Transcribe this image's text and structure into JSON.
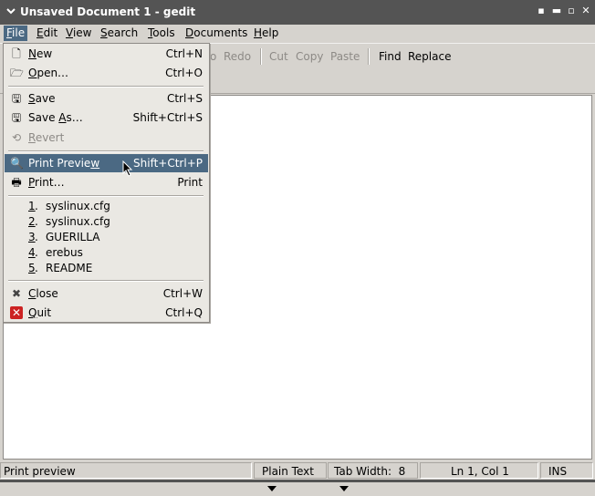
{
  "window": {
    "title": "Unsaved Document 1 - gedit"
  },
  "menubar": {
    "items": [
      {
        "label": "File",
        "u": "F",
        "rest": "ile"
      },
      {
        "label": "Edit",
        "u": "E",
        "rest": "dit"
      },
      {
        "label": "View",
        "u": "V",
        "rest": "iew"
      },
      {
        "label": "Search",
        "u": "S",
        "rest": "earch"
      },
      {
        "label": "Tools",
        "u": "T",
        "rest": "ools"
      },
      {
        "label": "Documents",
        "u": "D",
        "rest": "ocuments"
      },
      {
        "label": "Help",
        "u": "H",
        "rest": "elp"
      }
    ]
  },
  "toolbar": {
    "undo_fragment": "o",
    "redo": "Redo",
    "cut": "Cut",
    "copy": "Copy",
    "paste": "Paste",
    "find": "Find",
    "replace": "Replace"
  },
  "file_menu": {
    "new": {
      "u": "N",
      "rest": "ew",
      "accel": "Ctrl+N",
      "icon": "new-document-icon"
    },
    "open": {
      "u": "O",
      "rest": "pen…",
      "accel": "Ctrl+O",
      "icon": "open-folder-icon"
    },
    "save": {
      "u": "S",
      "rest": "ave",
      "accel": "Ctrl+S",
      "icon": "save-icon"
    },
    "save_as": {
      "pre": "Save ",
      "u": "A",
      "rest": "s…",
      "accel": "Shift+Ctrl+S",
      "icon": "save-as-icon"
    },
    "revert": {
      "u": "R",
      "rest": "evert",
      "icon": "revert-icon"
    },
    "print_preview": {
      "pre": "Print Previe",
      "u": "w",
      "accel": "Shift+Ctrl+P",
      "icon": "print-preview-icon"
    },
    "print": {
      "u": "P",
      "rest": "rint…",
      "accel": "Print",
      "icon": "printer-icon"
    },
    "recent": [
      {
        "num": "1",
        "name": "syslinux.cfg"
      },
      {
        "num": "2",
        "name": "syslinux.cfg"
      },
      {
        "num": "3",
        "name": "GUERILLA"
      },
      {
        "num": "4",
        "name": "erebus"
      },
      {
        "num": "5",
        "name": "README"
      }
    ],
    "close": {
      "u": "C",
      "rest": "lose",
      "accel": "Ctrl+W",
      "icon": "close-icon"
    },
    "quit": {
      "u": "Q",
      "rest": "uit",
      "accel": "Ctrl+Q",
      "icon": "quit-icon"
    }
  },
  "statusbar": {
    "message": "Print preview",
    "language": "Plain Text",
    "tab_width": "Tab Width:  8",
    "position": "Ln 1, Col 1",
    "mode": "INS"
  }
}
